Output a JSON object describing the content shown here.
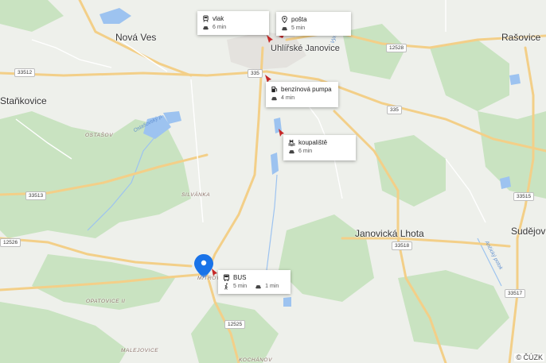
{
  "map": {
    "places": [
      {
        "id": "nova-ves",
        "label": "Nová Ves"
      },
      {
        "id": "rasovice",
        "label": "Rašovice"
      },
      {
        "id": "stankovice",
        "label": "Staňkovice"
      },
      {
        "id": "janovicka-lhota",
        "label": "Janovická Lhota"
      },
      {
        "id": "sudejov",
        "label": "Sudějov"
      },
      {
        "id": "uhlirske-janovice",
        "label": "Uhlířské Janovice"
      },
      {
        "id": "ostasov",
        "label": "OSTAŠOV"
      },
      {
        "id": "silvanka",
        "label": "SILVÁNKA"
      },
      {
        "id": "mitrov",
        "label": "MITROV"
      },
      {
        "id": "opatovice",
        "label": "OPATOVICE II"
      },
      {
        "id": "malejovice",
        "label": "MALEJOVICE"
      },
      {
        "id": "kochanov",
        "label": "KOCHÁNOV"
      }
    ],
    "roads": [
      "33512",
      "33513",
      "12526",
      "335",
      "335",
      "12528",
      "33515",
      "33518",
      "33517",
      "12525"
    ],
    "rivers": [
      "Ostašovský p.",
      "Výrovka",
      "Ančický potok"
    ],
    "copyright": "© ČÚZK"
  },
  "pois": [
    {
      "id": "vlak",
      "name": "vlak",
      "icon": "train-icon",
      "times": [
        {
          "mode": "car-icon",
          "value": "6 min"
        }
      ]
    },
    {
      "id": "posta",
      "name": "pošta",
      "icon": "pin-icon",
      "times": [
        {
          "mode": "car-icon",
          "value": "5 min"
        }
      ]
    },
    {
      "id": "benzin",
      "name": "benzínová pumpa",
      "icon": "fuel-icon",
      "times": [
        {
          "mode": "car-icon",
          "value": "4 min"
        }
      ]
    },
    {
      "id": "koupaliste",
      "name": "koupaliště",
      "icon": "pool-icon",
      "times": [
        {
          "mode": "car-icon",
          "value": "6 min"
        }
      ]
    },
    {
      "id": "bus",
      "name": "BUS",
      "icon": "bus-icon",
      "times": [
        {
          "mode": "walk-icon",
          "value": "5 min"
        },
        {
          "mode": "car-icon",
          "value": "1 min"
        }
      ]
    }
  ],
  "colors": {
    "forest": "#c8e4c0",
    "water": "#9cc4f0",
    "road": "#f5d08a",
    "pin": "#1a73e8"
  }
}
